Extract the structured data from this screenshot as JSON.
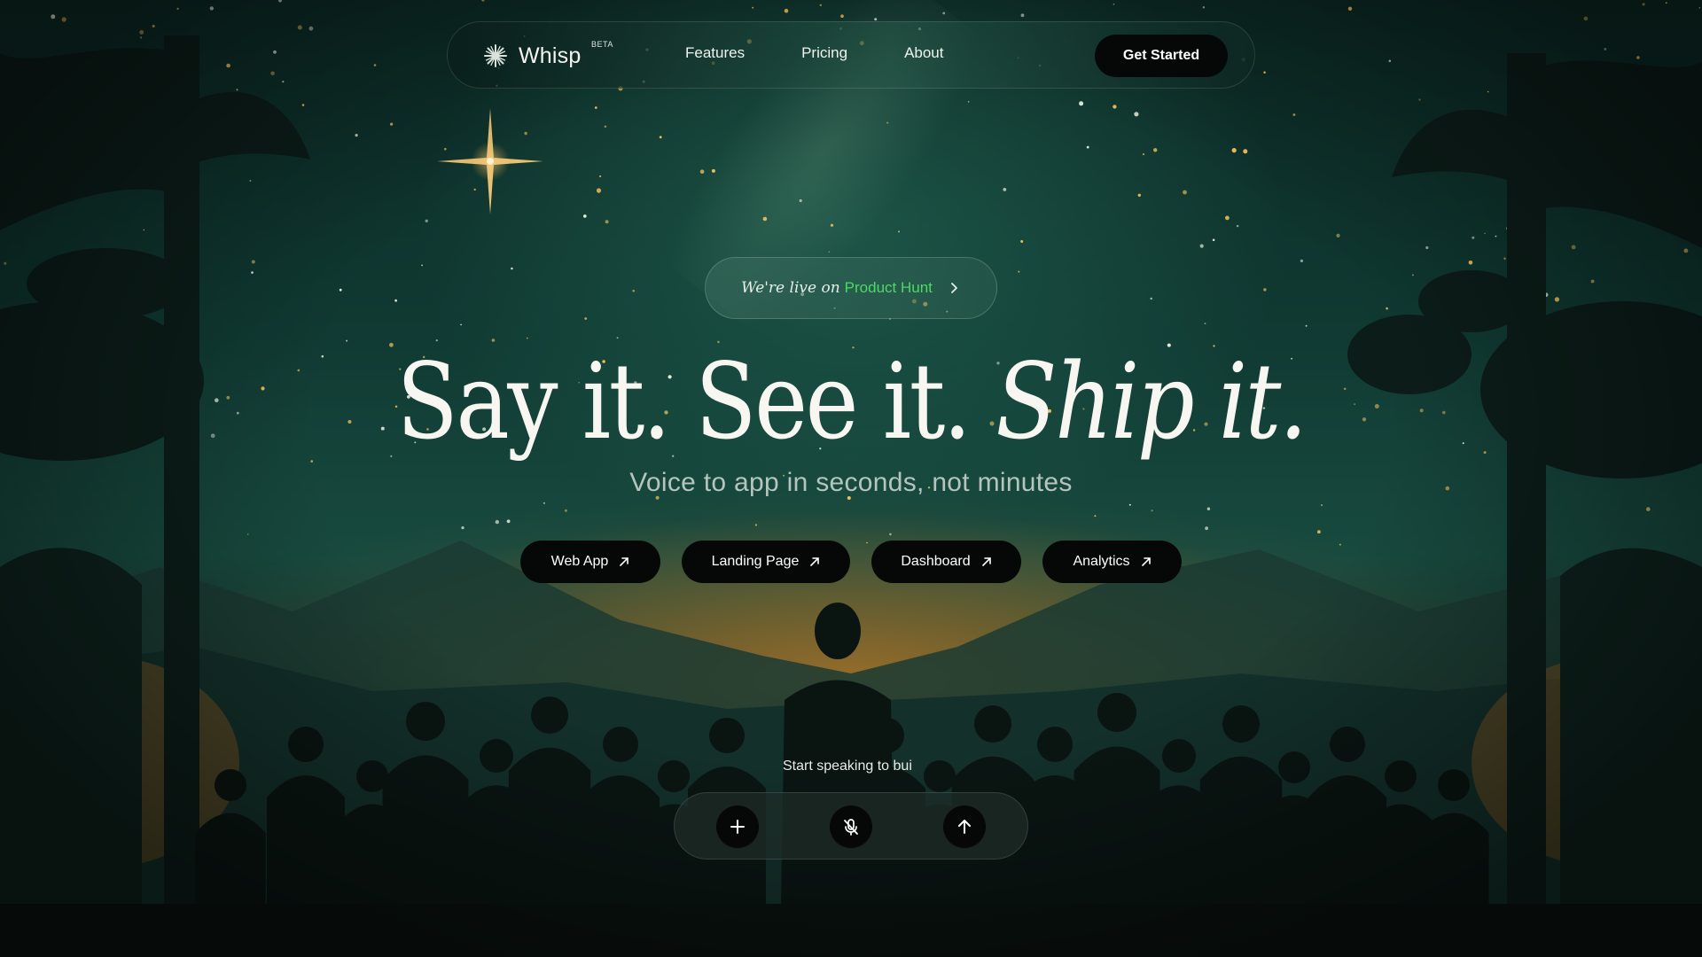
{
  "brand": {
    "name": "Whisp",
    "badge": "BETA",
    "icon": "sparkle-icon"
  },
  "nav": {
    "links": [
      "Features",
      "Pricing",
      "About"
    ],
    "cta_label": "Get Started"
  },
  "announcement": {
    "prefix": "We're live on",
    "highlight": "Product Hunt",
    "highlight_color": "#4cd964",
    "icon": "chevron-right-icon"
  },
  "hero": {
    "headline_plain": "Say it. See it.",
    "headline_italic": "Ship it.",
    "subheadline": "Voice to app in seconds, not minutes"
  },
  "templates": [
    {
      "label": "Web App",
      "icon": "arrow-up-right-icon"
    },
    {
      "label": "Landing Page",
      "icon": "arrow-up-right-icon"
    },
    {
      "label": "Dashboard",
      "icon": "arrow-up-right-icon"
    },
    {
      "label": "Analytics",
      "icon": "arrow-up-right-icon"
    }
  ],
  "voice": {
    "hint": "Start speaking to bui",
    "buttons": [
      "plus-icon",
      "mic-off-icon",
      "arrow-up-icon"
    ]
  },
  "colors": {
    "button_bg": "#060807",
    "sky": "#103a33",
    "glow": "#d68828"
  }
}
